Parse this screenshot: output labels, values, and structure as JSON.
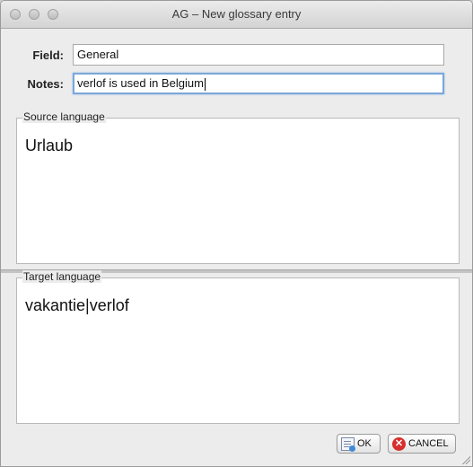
{
  "window": {
    "title": "AG – New glossary entry"
  },
  "form": {
    "field_label": "Field:",
    "field_value": "General",
    "notes_label": "Notes:",
    "notes_value": "verlof is used in Belgium"
  },
  "source": {
    "legend": "Source language",
    "text": "Urlaub"
  },
  "target": {
    "legend": "Target language",
    "text": "vakantie|verlof"
  },
  "buttons": {
    "ok_label": "OK",
    "cancel_label": "CANCEL"
  },
  "icons": {
    "ok": "ok-document-icon",
    "cancel": "cancel-x-icon",
    "close": "close-window-icon",
    "minimize": "minimize-window-icon",
    "zoom": "zoom-window-icon"
  }
}
